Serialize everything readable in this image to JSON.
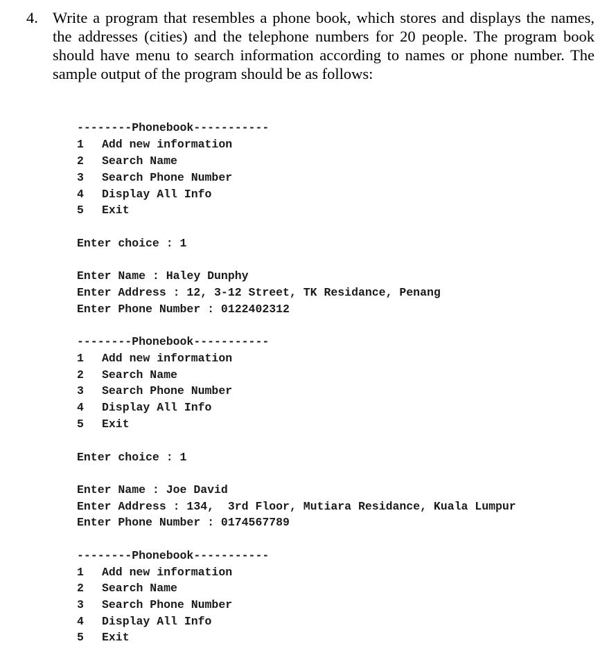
{
  "question": {
    "number": "4.",
    "text": "Write a program that resembles a phone book, which stores and displays the names, the addresses (cities) and the telephone numbers for 20 people. The program book should have menu to search information according to names or phone number. The sample output of the program should be as follows:"
  },
  "sample_output": {
    "menu_header": "--------Phonebook-----------",
    "menu_items": [
      {
        "num": "1",
        "label": "Add new information"
      },
      {
        "num": "2",
        "label": "Search Name"
      },
      {
        "num": "3",
        "label": "Search Phone Number"
      },
      {
        "num": "4",
        "label": "Display All Info"
      },
      {
        "num": "5",
        "label": "Exit"
      }
    ],
    "blocks": [
      {
        "choice_prompt": "Enter choice : 1",
        "name_line": "Enter Name : Haley Dunphy",
        "address_line": "Enter Address : 12, 3-12 Street, TK Residance, Penang",
        "phone_line": "Enter Phone Number : 0122402312"
      },
      {
        "choice_prompt": "Enter choice : 1",
        "name_line": "Enter Name : Joe David",
        "address_line": "Enter Address : 134,  3rd Floor, Mutiara Residance, Kuala Lumpur",
        "phone_line": "Enter Phone Number : 0174567789"
      }
    ]
  }
}
